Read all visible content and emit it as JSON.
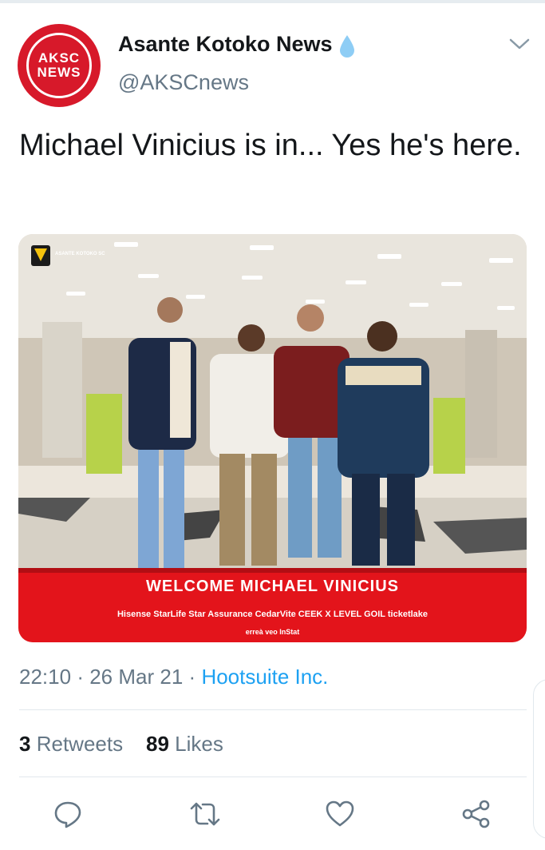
{
  "author": {
    "name": "Asante Kotoko News",
    "handle": "@AKSCnews",
    "avatar_line1": "AKSC",
    "avatar_line2": "NEWS",
    "avatar_color": "#d7192a",
    "verified_icon": "drop-icon"
  },
  "tweet": {
    "text": "Michael Vinicius is in... Yes he's here.",
    "media": {
      "banner": "WELCOME MICHAEL VINICIUS",
      "club_tag": "ASANTE KOTOKO SC",
      "sponsors_line1": "Hisense  StarLife  Star Assurance  CedarVite  CEEK  X LEVEL  GOIL  ticketlake",
      "sponsors_line2": "erreà  veo  InStat",
      "banner_color": "#e3141b"
    },
    "time": "22:10",
    "date": "26 Mar 21",
    "source": "Hootsuite Inc.",
    "separator": "·"
  },
  "stats": {
    "retweets_count": "3",
    "retweets_label": "Retweets",
    "likes_count": "89",
    "likes_label": "Likes"
  },
  "actions": [
    "reply-icon",
    "retweet-icon",
    "like-icon",
    "share-icon"
  ],
  "colors": {
    "link": "#1da1f2",
    "secondary": "#657786",
    "text": "#14171a"
  }
}
